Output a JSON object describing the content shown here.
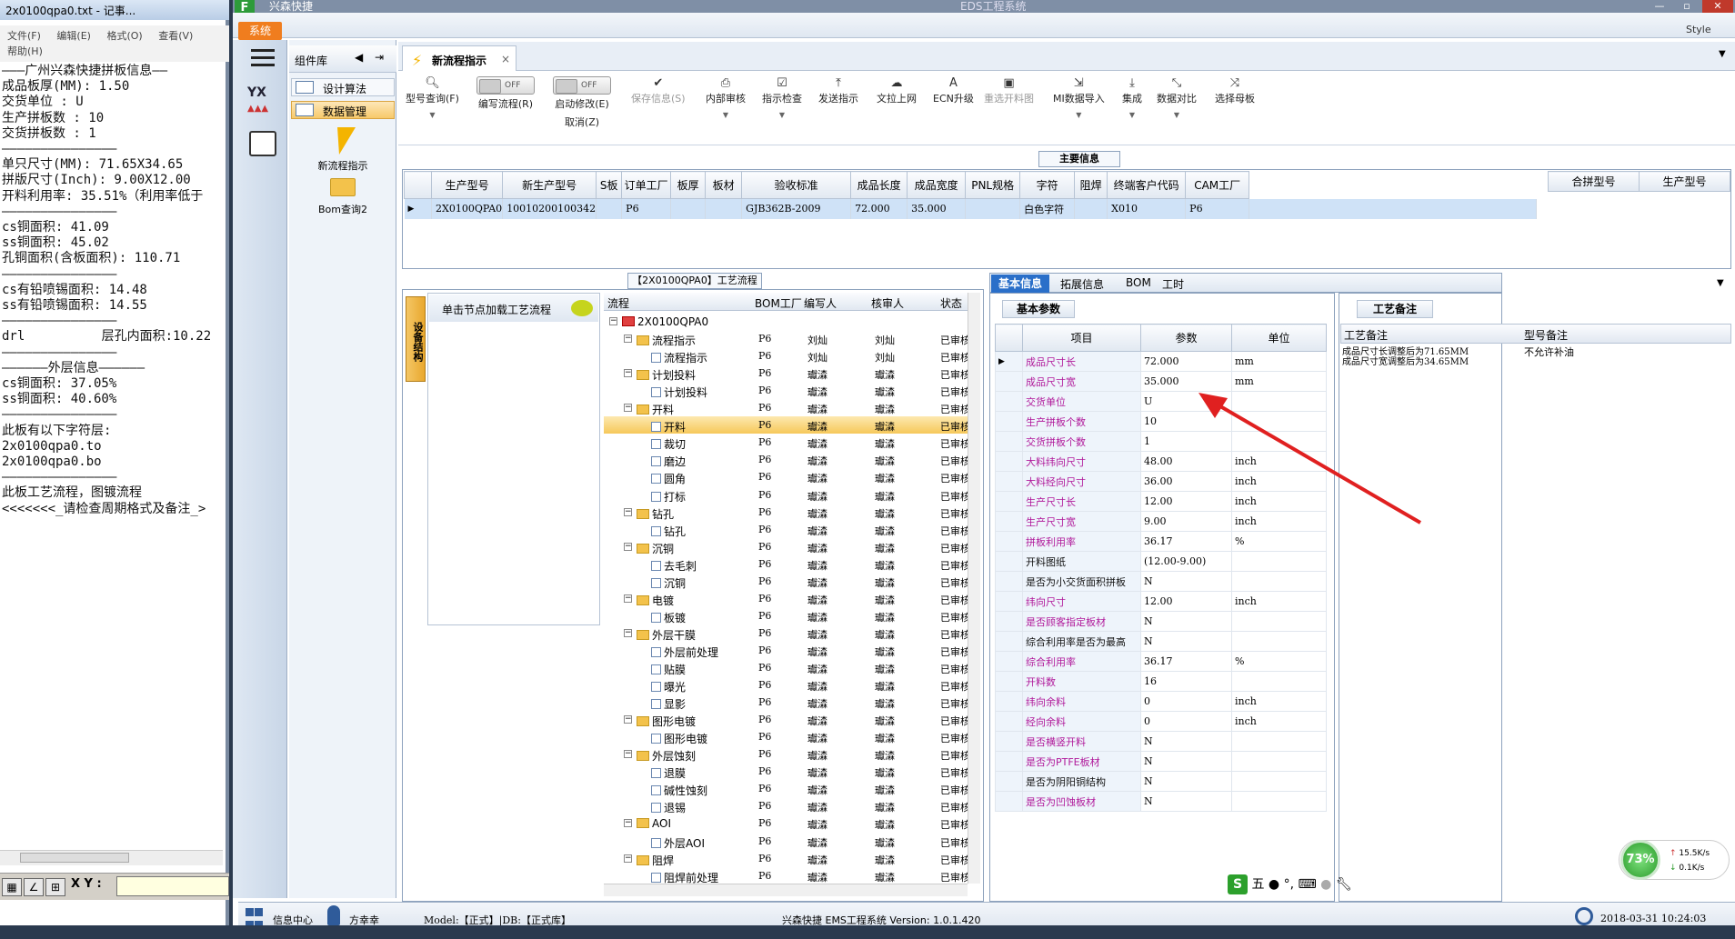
{
  "notepad": {
    "title": "2x0100qpa0.txt - 记事...",
    "menu": [
      "文件(F)",
      "编辑(E)",
      "格式(O)",
      "查看(V)",
      "帮助(H)"
    ],
    "lines": [
      "———广州兴森快捷拼板信息——",
      "成品板厚(MM): 1.50",
      "交货单位 : U",
      "生产拼板数 : 10",
      "交货拼板数 : 1",
      "———————————————",
      "单只尺寸(MM): 71.65X34.65",
      "拼版尺寸(Inch): 9.00X12.00",
      "开料利用率: 35.51%（利用率低于",
      "———————————————",
      "cs铜面积: 41.09",
      "ss铜面积: 45.02",
      "孔铜面积(含板面积): 110.71",
      "———————————————",
      "cs有铅喷锡面积: 14.48",
      "ss有铅喷锡面积: 14.55",
      "———————————————",
      "drl          层孔内面积:10.22",
      "———————————————",
      "——————外层信息——————",
      "cs铜面积: 37.05%",
      "ss铜面积: 40.60%",
      "———————————————",
      "此板有以下字符层:",
      "2x0100qpa0.to",
      "2x0100qpa0.bo",
      "———————————————",
      "此板工艺流程，图镀流程",
      "<<<<<<<_请检查周期格式及备注_>"
    ],
    "xy_label": "X Y :"
  },
  "window": {
    "app_title": "兴森快捷",
    "center_title": "EDS工程系统",
    "system_button": "系统",
    "style_label": "Style"
  },
  "component_panel": {
    "header": "组件库",
    "items": [
      "设计算法",
      "数据管理"
    ],
    "big_items": [
      "新流程指示",
      "Bom查询2"
    ]
  },
  "tab": {
    "label": "新流程指示",
    "close": "×"
  },
  "toolbar": {
    "query": "型号查询(F)",
    "edit_flow": "编写流程(R)",
    "toggle_off": "OFF",
    "start_modify": "启动修改(E)",
    "cancel": "取消(Z)",
    "save_info": "保存信息(S)",
    "internal_review": "内部审核",
    "instruction_check": "指示检查",
    "send_instruction": "发送指示",
    "upload": "文拉上网",
    "ecn_upgrade": "ECN升级",
    "reselect_map": "重选开料图",
    "mi_import": "MI数据导入",
    "integrate": "集成",
    "data_compare": "数据对比",
    "select_master": "选择母板"
  },
  "main_info": {
    "title": "主要信息",
    "headers": [
      "生产型号",
      "新生产型号",
      "S板",
      "订单工厂",
      "板厚",
      "板材",
      "验收标准",
      "成品长度",
      "成品宽度",
      "PNL规格",
      "字符",
      "阻焊",
      "终端客户代码",
      "CAM工厂"
    ],
    "row": [
      "2X0100QPA0",
      "10010200100342",
      "",
      "P6",
      "",
      "",
      "GJB362B-2009",
      "72.000",
      "35.000",
      "",
      "白色字符",
      "",
      "X010",
      "P6"
    ],
    "right_headers": [
      "合拼型号",
      "生产型号"
    ]
  },
  "flow": {
    "header": "【2X0100QPA0】工艺流程",
    "vertical_tab": "设备结构",
    "node_hint": "单击节点加载工艺流程",
    "columns": [
      "流程",
      "BOM工厂",
      "编写人",
      "核审人",
      "状态"
    ],
    "rows": [
      {
        "lvl": 0,
        "name": "2X0100QPA0",
        "bom": "",
        "w": "",
        "r": "",
        "s": "",
        "type": "root"
      },
      {
        "lvl": 1,
        "name": "流程指示",
        "bom": "P6",
        "w": "刘灿",
        "r": "刘灿",
        "s": "已审核",
        "type": "folder"
      },
      {
        "lvl": 2,
        "name": "流程指示",
        "bom": "P6",
        "w": "刘灿",
        "r": "刘灿",
        "s": "已审核",
        "type": "doc"
      },
      {
        "lvl": 1,
        "name": "计划投料",
        "bom": "P6",
        "w": "瓛潹",
        "r": "瓛潹",
        "s": "已审核",
        "type": "folder"
      },
      {
        "lvl": 2,
        "name": "计划投料",
        "bom": "P6",
        "w": "瓛潹",
        "r": "瓛潹",
        "s": "已审核",
        "type": "doc"
      },
      {
        "lvl": 1,
        "name": "开料",
        "bom": "P6",
        "w": "瓛潹",
        "r": "瓛潹",
        "s": "已审核",
        "type": "folder"
      },
      {
        "lvl": 2,
        "name": "开料",
        "bom": "P6",
        "w": "瓛潹",
        "r": "瓛潹",
        "s": "已审核",
        "type": "doc",
        "hl": true
      },
      {
        "lvl": 2,
        "name": "裁切",
        "bom": "P6",
        "w": "瓛潹",
        "r": "瓛潹",
        "s": "已审核",
        "type": "doc"
      },
      {
        "lvl": 2,
        "name": "磨边",
        "bom": "P6",
        "w": "瓛潹",
        "r": "瓛潹",
        "s": "已审核",
        "type": "doc"
      },
      {
        "lvl": 2,
        "name": "圆角",
        "bom": "P6",
        "w": "瓛潹",
        "r": "瓛潹",
        "s": "已审核",
        "type": "doc"
      },
      {
        "lvl": 2,
        "name": "打标",
        "bom": "P6",
        "w": "瓛潹",
        "r": "瓛潹",
        "s": "已审核",
        "type": "doc"
      },
      {
        "lvl": 1,
        "name": "钻孔",
        "bom": "P6",
        "w": "瓛潹",
        "r": "瓛潹",
        "s": "已审核",
        "type": "folder"
      },
      {
        "lvl": 2,
        "name": "钻孔",
        "bom": "P6",
        "w": "瓛潹",
        "r": "瓛潹",
        "s": "已审核",
        "type": "doc"
      },
      {
        "lvl": 1,
        "name": "沉铜",
        "bom": "P6",
        "w": "瓛潹",
        "r": "瓛潹",
        "s": "已审核",
        "type": "folder"
      },
      {
        "lvl": 2,
        "name": "去毛刺",
        "bom": "P6",
        "w": "瓛潹",
        "r": "瓛潹",
        "s": "已审核",
        "type": "doc"
      },
      {
        "lvl": 2,
        "name": "沉铜",
        "bom": "P6",
        "w": "瓛潹",
        "r": "瓛潹",
        "s": "已审核",
        "type": "doc"
      },
      {
        "lvl": 1,
        "name": "电镀",
        "bom": "P6",
        "w": "瓛潹",
        "r": "瓛潹",
        "s": "已审核",
        "type": "folder"
      },
      {
        "lvl": 2,
        "name": "板镀",
        "bom": "P6",
        "w": "瓛潹",
        "r": "瓛潹",
        "s": "已审核",
        "type": "doc"
      },
      {
        "lvl": 1,
        "name": "外层干膜",
        "bom": "P6",
        "w": "瓛潹",
        "r": "瓛潹",
        "s": "已审核",
        "type": "folder"
      },
      {
        "lvl": 2,
        "name": "外层前处理",
        "bom": "P6",
        "w": "瓛潹",
        "r": "瓛潹",
        "s": "已审核",
        "type": "doc"
      },
      {
        "lvl": 2,
        "name": "贴膜",
        "bom": "P6",
        "w": "瓛潹",
        "r": "瓛潹",
        "s": "已审核",
        "type": "doc"
      },
      {
        "lvl": 2,
        "name": "曝光",
        "bom": "P6",
        "w": "瓛潹",
        "r": "瓛潹",
        "s": "已审核",
        "type": "doc"
      },
      {
        "lvl": 2,
        "name": "显影",
        "bom": "P6",
        "w": "瓛潹",
        "r": "瓛潹",
        "s": "已审核",
        "type": "doc"
      },
      {
        "lvl": 1,
        "name": "图形电镀",
        "bom": "P6",
        "w": "瓛潹",
        "r": "瓛潹",
        "s": "已审核",
        "type": "folder"
      },
      {
        "lvl": 2,
        "name": "图形电镀",
        "bom": "P6",
        "w": "瓛潹",
        "r": "瓛潹",
        "s": "已审核",
        "type": "doc"
      },
      {
        "lvl": 1,
        "name": "外层蚀刻",
        "bom": "P6",
        "w": "瓛潹",
        "r": "瓛潹",
        "s": "已审核",
        "type": "folder"
      },
      {
        "lvl": 2,
        "name": "退膜",
        "bom": "P6",
        "w": "瓛潹",
        "r": "瓛潹",
        "s": "已审核",
        "type": "doc"
      },
      {
        "lvl": 2,
        "name": "碱性蚀刻",
        "bom": "P6",
        "w": "瓛潹",
        "r": "瓛潹",
        "s": "已审核",
        "type": "doc"
      },
      {
        "lvl": 2,
        "name": "退锡",
        "bom": "P6",
        "w": "瓛潹",
        "r": "瓛潹",
        "s": "已审核",
        "type": "doc"
      },
      {
        "lvl": 1,
        "name": "AOI",
        "bom": "P6",
        "w": "瓛潹",
        "r": "瓛潹",
        "s": "已审核",
        "type": "folder"
      },
      {
        "lvl": 2,
        "name": "外层AOI",
        "bom": "P6",
        "w": "瓛潹",
        "r": "瓛潹",
        "s": "已审核",
        "type": "doc"
      },
      {
        "lvl": 1,
        "name": "阻焊",
        "bom": "P6",
        "w": "瓛潹",
        "r": "瓛潹",
        "s": "已审核",
        "type": "folder"
      },
      {
        "lvl": 2,
        "name": "阻焊前处理",
        "bom": "P6",
        "w": "瓛潹",
        "r": "瓛潹",
        "s": "已审核",
        "type": "doc"
      }
    ]
  },
  "right_tabs": [
    "基本信息",
    "拓展信息",
    "BOM",
    "工时"
  ],
  "basic_params": {
    "title": "基本参数",
    "headers": [
      "项目",
      "参数",
      "单位"
    ],
    "rows": [
      {
        "k": "成品尺寸长",
        "v": "72.000",
        "u": "mm",
        "black": false
      },
      {
        "k": "成品尺寸宽",
        "v": "35.000",
        "u": "mm",
        "black": false
      },
      {
        "k": "交货单位",
        "v": "U",
        "u": "",
        "black": false
      },
      {
        "k": "生产拼板个数",
        "v": "10",
        "u": "",
        "black": false
      },
      {
        "k": "交货拼板个数",
        "v": "1",
        "u": "",
        "black": false
      },
      {
        "k": "大料纬向尺寸",
        "v": "48.00",
        "u": "inch",
        "black": false
      },
      {
        "k": "大料经向尺寸",
        "v": "36.00",
        "u": "inch",
        "black": false
      },
      {
        "k": "生产尺寸长",
        "v": "12.00",
        "u": "inch",
        "black": false
      },
      {
        "k": "生产尺寸宽",
        "v": "9.00",
        "u": "inch",
        "black": false
      },
      {
        "k": "拼板利用率",
        "v": "36.17",
        "u": "%",
        "black": false
      },
      {
        "k": "开料图纸",
        "v": "(12.00-9.00)",
        "u": "",
        "black": true
      },
      {
        "k": "是否为小交货面积拼板",
        "v": "N",
        "u": "",
        "black": true
      },
      {
        "k": "纬向尺寸",
        "v": "12.00",
        "u": "inch",
        "black": false
      },
      {
        "k": "是否顾客指定板材",
        "v": "N",
        "u": "",
        "black": false
      },
      {
        "k": "综合利用率是否为最高",
        "v": "N",
        "u": "",
        "black": true
      },
      {
        "k": "综合利用率",
        "v": "36.17",
        "u": "%",
        "black": false
      },
      {
        "k": "开料数",
        "v": "16",
        "u": "",
        "black": false
      },
      {
        "k": "纬向余料",
        "v": "0",
        "u": "inch",
        "black": false
      },
      {
        "k": "经向余料",
        "v": "0",
        "u": "inch",
        "black": false
      },
      {
        "k": "是否横竖开料",
        "v": "N",
        "u": "",
        "black": false
      },
      {
        "k": "是否为PTFE板材",
        "v": "N",
        "u": "",
        "black": false
      },
      {
        "k": "是否为阴阳铜结构",
        "v": "N",
        "u": "",
        "black": true
      },
      {
        "k": "是否为凹蚀板材",
        "v": "N",
        "u": "",
        "black": false
      }
    ]
  },
  "remarks": {
    "title": "工艺备注",
    "col1": "工艺备注",
    "col2": "型号备注",
    "text1": "成品尺寸长调整后为71.65MM\n成品尺寸宽调整后为34.65MM",
    "text2": "不允许补油"
  },
  "network": {
    "percent": "73%",
    "up": "15.5K/s",
    "down": "0.1K/s"
  },
  "ime": {
    "char": "五"
  },
  "status": {
    "info_center": "信息中心",
    "user": "方幸幸",
    "model": "Model:【正式】|DB:【正式库】",
    "system": "兴森快捷 EMS工程系统 Version: 1.0.1.420",
    "datetime": "2018-03-31 10:24:03"
  },
  "colors": {
    "accent": "#f07d1e",
    "highlight_key": "#b0189a",
    "arrow": "#e02020",
    "tab_active": "#2a6fc9"
  }
}
